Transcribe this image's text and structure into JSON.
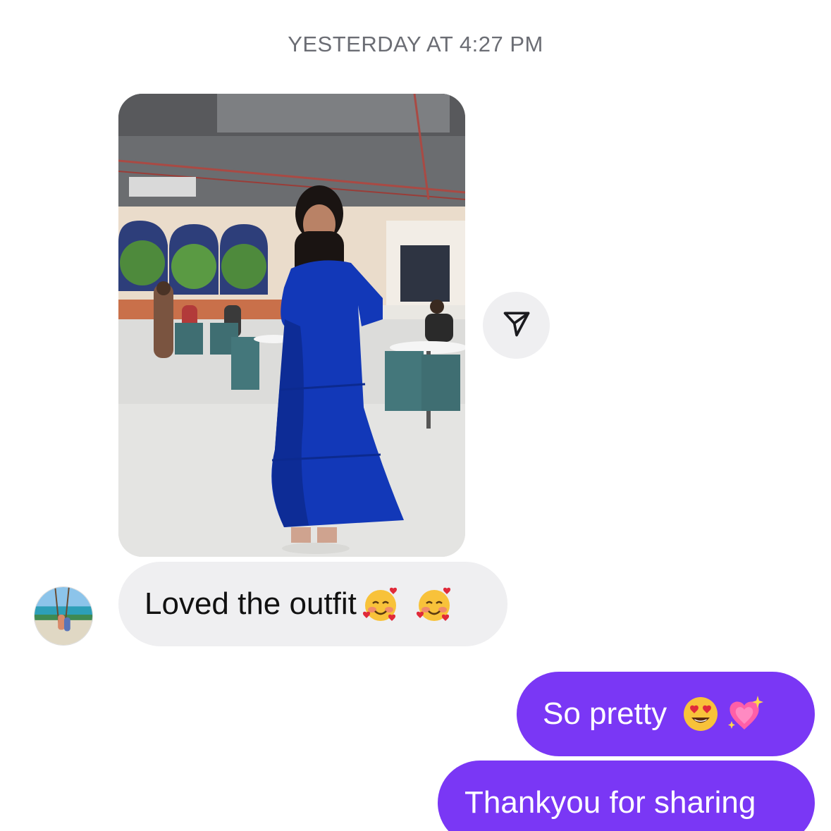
{
  "thread": {
    "timestamp": "YESTERDAY AT 4:27 PM"
  },
  "messages": {
    "received_text": "Loved the outfit",
    "received_emojis": [
      "smiling-face-with-hearts-icon",
      "smiling-face-with-hearts-icon"
    ],
    "sent_1_text": "So pretty",
    "sent_1_emojis": [
      "heart-eyes-icon",
      "sparkling-heart-icon"
    ],
    "sent_2_text": "Thankyou for sharing"
  },
  "colors": {
    "sent_bubble": "#7a37f5",
    "received_bubble": "#efeff1",
    "timestamp_text": "#6b6d74"
  },
  "icons": {
    "share": "send-icon"
  }
}
